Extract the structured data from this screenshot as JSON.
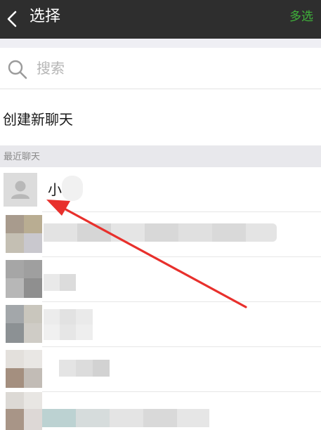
{
  "header": {
    "back_icon": "chevron-left-icon",
    "title": "选择",
    "multi_select_label": "多选",
    "background_color": "#2e2e2e",
    "accent_color": "#3fb23a"
  },
  "search": {
    "icon": "search-icon",
    "placeholder": "搜索",
    "value": ""
  },
  "new_chat": {
    "label": "创建新聊天"
  },
  "recent": {
    "section_label": "最近聊天",
    "contacts": [
      {
        "name": "小",
        "avatar_icon": "default-avatar-icon"
      }
    ]
  },
  "annotation": {
    "arrow_icon": "red-arrow-icon",
    "color": "#e8302c"
  }
}
